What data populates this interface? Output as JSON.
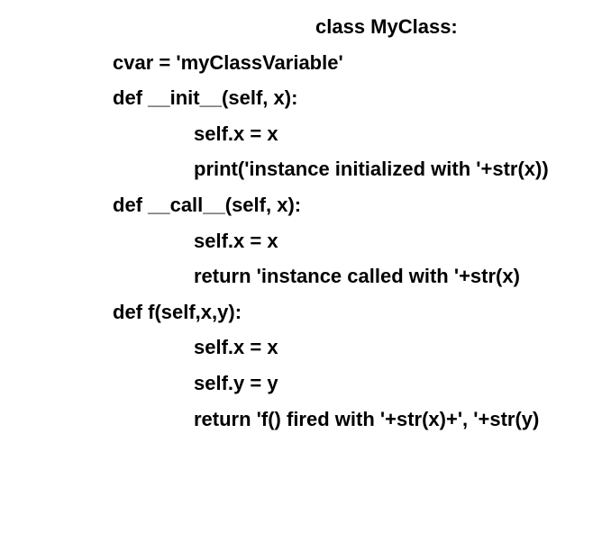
{
  "code": {
    "line1": "class MyClass:",
    "line2": "cvar = 'myClassVariable'",
    "line3": "def __init__(self, x):",
    "line4": "self.x = x",
    "line5": "print('instance initialized with '+str(x))",
    "line6": "def __call__(self, x):",
    "line7": "self.x = x",
    "line8": "return 'instance called with '+str(x)",
    "line9": "def f(self,x,y):",
    "line10": "self.x = x",
    "line11": "self.y = y",
    "line12": "return 'f() fired with '+str(x)+', '+str(y)"
  }
}
